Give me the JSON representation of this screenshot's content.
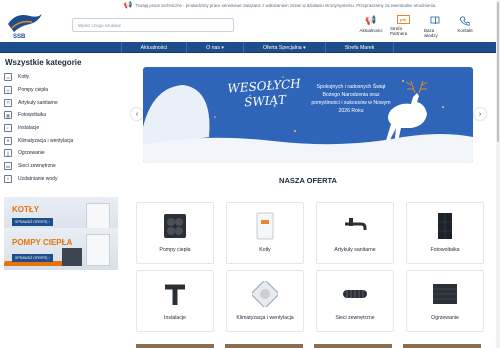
{
  "banner": {
    "icon": "megaphone-icon",
    "text": "Trwają prace techniczne - prowadzimy prace serwisowe związane z wdrażaniem zmian w działaniu strony/systemu. Przepraszamy za ewentualne utrudnienia."
  },
  "header": {
    "logo_text": "SSB",
    "search_placeholder": "Wpisz czego szukasz",
    "icons": [
      {
        "label": "Aktualności",
        "icon": "megaphone-icon"
      },
      {
        "label": "Strefa Partnera",
        "icon": "partner-badge-icon",
        "badge": "ptk"
      },
      {
        "label": "Baza wiedzy",
        "icon": "book-icon"
      },
      {
        "label": "Kontakt",
        "icon": "phone-icon"
      }
    ]
  },
  "nav": {
    "items": [
      "Aktualności",
      "O nas ▾",
      "Oferta Specjalna ▾",
      "Strefa Marek"
    ]
  },
  "sidebar": {
    "title": "Wszystkie kategorie",
    "items": [
      {
        "label": "Kotły",
        "icon": "boiler-icon"
      },
      {
        "label": "Pompy ciepła",
        "icon": "heat-pump-icon"
      },
      {
        "label": "Artykuły sanitarne",
        "icon": "sanitary-icon"
      },
      {
        "label": "Fotowoltaika",
        "icon": "solar-panel-icon"
      },
      {
        "label": "Instalacje",
        "icon": "pipe-icon"
      },
      {
        "label": "Klimatyzacja i wentylacja",
        "icon": "fan-icon"
      },
      {
        "label": "Ogrzewanie",
        "icon": "radiator-icon"
      },
      {
        "label": "Sieci zewnętrzne",
        "icon": "network-icon"
      },
      {
        "label": "Uzdatnianie wody",
        "icon": "water-drop-icon"
      }
    ]
  },
  "promos": [
    {
      "title": "KOTŁY",
      "button": "SPRAWDŹ OFERTĘ ›"
    },
    {
      "title": "POMPY CIEPŁA",
      "button": "SPRAWDŹ OFERTĘ ›"
    }
  ],
  "hero": {
    "title_line1": "WESOŁYCH",
    "title_line2": "ŚWIĄT",
    "message": "Spokojnych i radosnych Świąt Bożego Narodzenia oraz pomyślności i sukcesów w Nowym 2026 Roku",
    "prev_icon": "chevron-left-icon",
    "next_icon": "chevron-right-icon",
    "prev_glyph": "‹",
    "next_glyph": "›"
  },
  "offer": {
    "title": "NASZA OFERTA",
    "cards": [
      {
        "label": "Pompy ciepła",
        "icon": "heat-pump-icon"
      },
      {
        "label": "Kotły",
        "icon": "boiler-icon"
      },
      {
        "label": "Artykuły sanitarne",
        "icon": "faucet-icon"
      },
      {
        "label": "Fotowoltaika",
        "icon": "solar-panel-icon"
      },
      {
        "label": "Instalacje",
        "icon": "pipe-fitting-icon"
      },
      {
        "label": "Klimatyzacja i wentylacja",
        "icon": "ceiling-fan-icon"
      },
      {
        "label": "Sieci zewnętrzne",
        "icon": "corrugated-pipe-icon"
      },
      {
        "label": "Ogrzewanie",
        "icon": "floor-heating-icon"
      }
    ]
  }
}
